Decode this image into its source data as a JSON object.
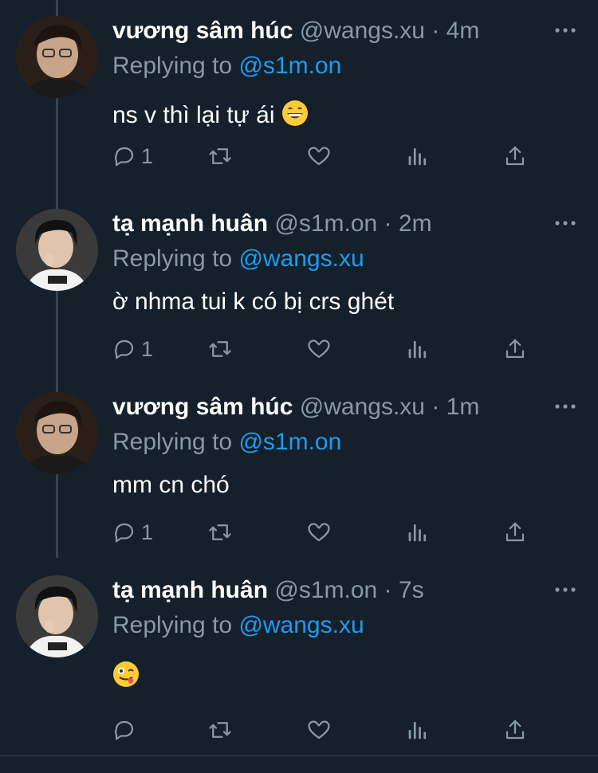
{
  "colors": {
    "background": "#15202b",
    "secondary_text": "#8899a6",
    "link": "#1d9bf0",
    "divider": "#38444d"
  },
  "tweets": [
    {
      "name": "vương sâm húc",
      "handle": "@wangs.xu",
      "separator": "·",
      "time": "4m",
      "replying_prefix": "Replying to",
      "replying_to": "@s1m.on",
      "text": "ns v thì lại tự ái",
      "emoji": "grinning-face-emoji",
      "reply_count": "1",
      "avatar": "avatar-photo"
    },
    {
      "name": "tạ mạnh huân",
      "handle": "@s1m.on",
      "separator": "·",
      "time": "2m",
      "replying_prefix": "Replying to",
      "replying_to": "@wangs.xu",
      "text": "ờ nhma tui k có bị crs ghét",
      "reply_count": "1",
      "avatar": "avatar-photo"
    },
    {
      "name": "vương sâm húc",
      "handle": "@wangs.xu",
      "separator": "·",
      "time": "1m",
      "replying_prefix": "Replying to",
      "replying_to": "@s1m.on",
      "text": "mm cn chó",
      "reply_count": "1",
      "avatar": "avatar-photo"
    },
    {
      "name": "tạ mạnh huân",
      "handle": "@s1m.on",
      "separator": "·",
      "time": "7s",
      "replying_prefix": "Replying to",
      "replying_to": "@wangs.xu",
      "text": "",
      "emoji": "winking-tongue-emoji",
      "reply_count": "",
      "avatar": "avatar-photo"
    }
  ],
  "icons": [
    "reply-icon",
    "retweet-icon",
    "like-icon",
    "stats-icon",
    "share-icon",
    "more-icon"
  ]
}
